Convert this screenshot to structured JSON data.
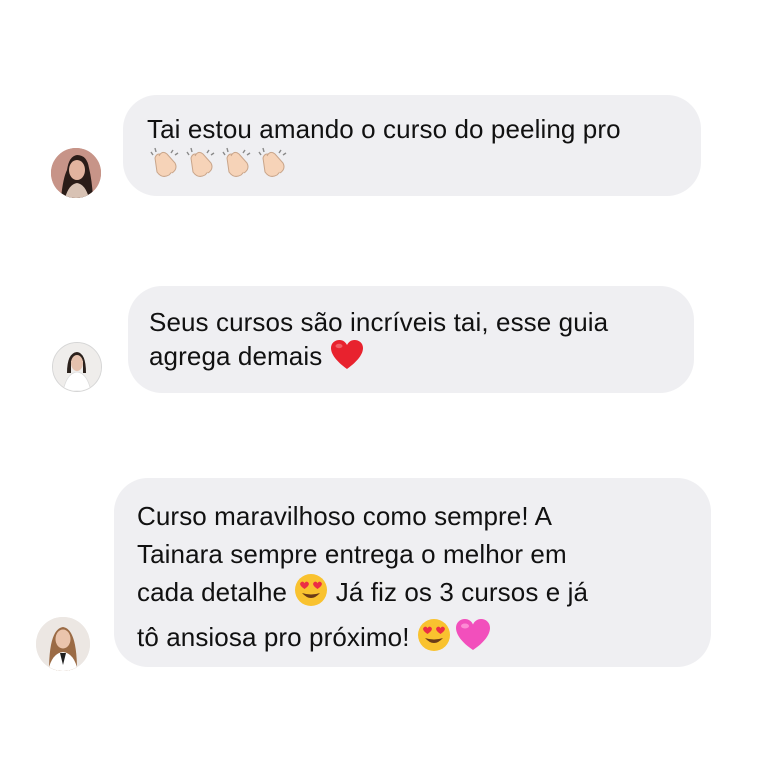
{
  "messages": [
    {
      "avatar": "profile-photo-woman-dark-hair",
      "lines": [
        {
          "text": "Tai estou amando o curso do peeling pro",
          "emojis": []
        },
        {
          "text": "",
          "emojis": [
            "clapping-hands",
            "clapping-hands",
            "clapping-hands",
            "clapping-hands"
          ]
        }
      ]
    },
    {
      "avatar": "profile-photo-woman-white-coat",
      "lines": [
        {
          "text": "Seus cursos são incríveis tai, esse guia",
          "emojis": []
        },
        {
          "text": "agrega demais ",
          "emojis": [
            "red-heart"
          ]
        }
      ]
    },
    {
      "avatar": "profile-photo-woman-long-hair",
      "lines": [
        {
          "text": "Curso maravilhoso como sempre! A"
        },
        {
          "text": "Tainara sempre entrega o melhor em"
        },
        {
          "text": "cada detalhe ",
          "after": " Já fiz os 3 cursos e já",
          "emojis": [
            "heart-eyes-face"
          ]
        },
        {
          "text": "tô ansiosa pro próximo! ",
          "emojis": [
            "heart-eyes-face",
            "pink-heart"
          ]
        }
      ]
    }
  ],
  "colors": {
    "bubble": "#efeff2",
    "text": "#111111",
    "background": "#ffffff"
  }
}
